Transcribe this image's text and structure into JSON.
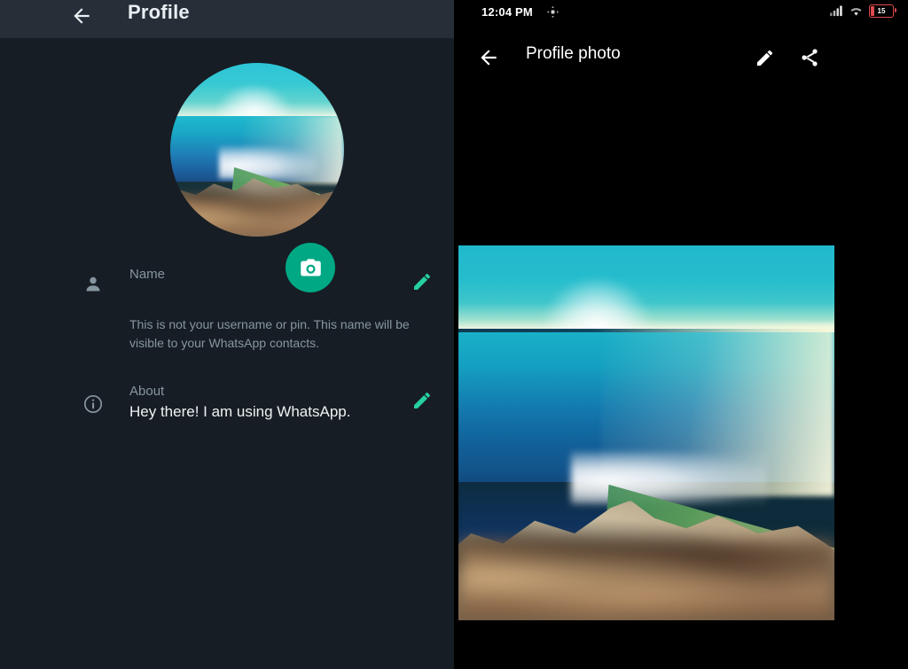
{
  "left_panel": {
    "header": {
      "back_icon": "arrow-left-icon",
      "title": "Profile"
    },
    "avatar": {
      "alt": "profile-photo-thumbnail",
      "camera_icon": "camera-icon"
    },
    "rows": [
      {
        "icon": "person-icon",
        "label": "Name",
        "value": "",
        "help": "This is not your username or pin. This name will be visible to your WhatsApp contacts.",
        "edit_icon": "pencil-icon"
      },
      {
        "icon": "info-circle-icon",
        "label": "About",
        "value": "Hey there! I am using WhatsApp.",
        "edit_icon": "pencil-icon"
      }
    ]
  },
  "right_panel": {
    "statusbar": {
      "time": "12:04 PM",
      "notification_icon": "app-notification-icon",
      "signal_icon": "cellular-signal-icon",
      "wifi_icon": "wifi-icon",
      "battery_icon": "battery-low-icon",
      "battery_level": "15"
    },
    "header": {
      "back_icon": "arrow-left-icon",
      "title": "Profile photo",
      "edit_icon": "pencil-icon",
      "share_icon": "share-icon"
    },
    "photo": {
      "alt": "profile-photo-full"
    }
  },
  "colors": {
    "left_background": "#171d24",
    "left_appbar": "#262f38",
    "right_background": "#000000",
    "accent_green": "#00a884",
    "accent_pencil": "#26d0a0",
    "muted_text": "#8696a0",
    "primary_text": "#eef2f4",
    "battery_red": "#e0484f"
  }
}
